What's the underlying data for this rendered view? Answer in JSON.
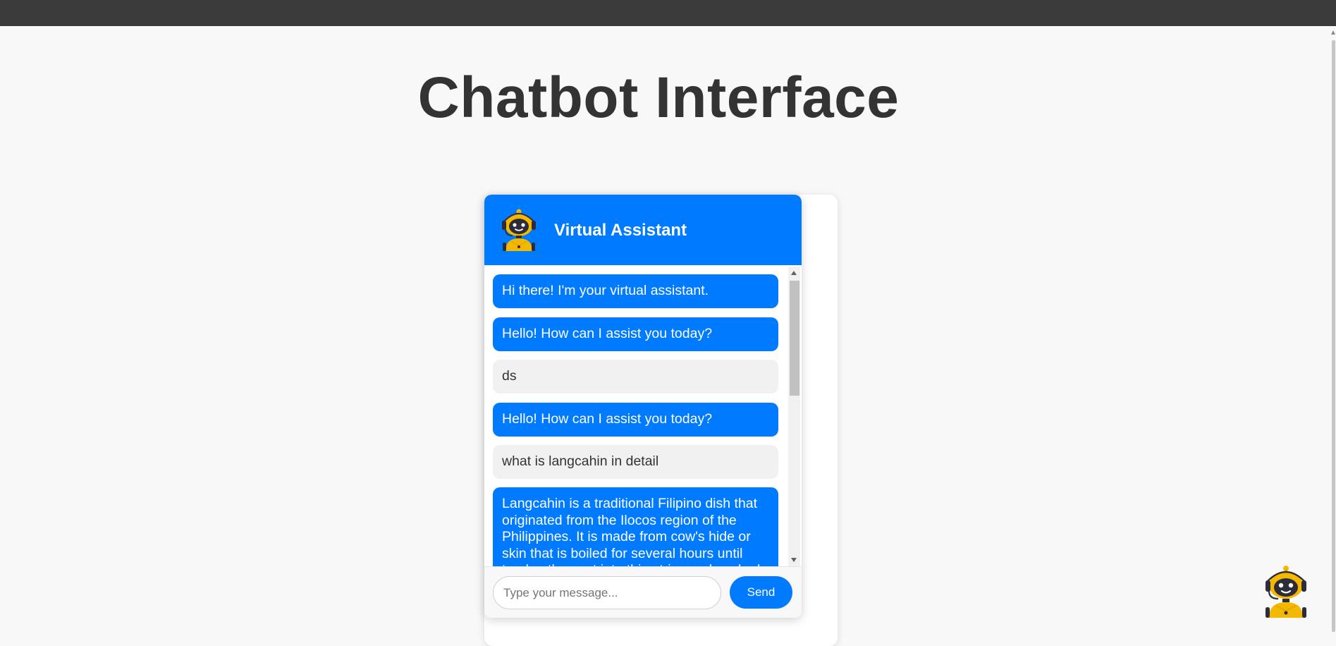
{
  "page": {
    "title": "Chatbot Interface"
  },
  "chat": {
    "header_title": "Virtual Assistant",
    "messages": [
      {
        "sender": "bot",
        "text": "Hi there! I'm your virtual assistant."
      },
      {
        "sender": "bot",
        "text": "Hello! How can I assist you today?"
      },
      {
        "sender": "user",
        "text": "ds"
      },
      {
        "sender": "bot",
        "text": "Hello! How can I assist you today?"
      },
      {
        "sender": "user",
        "text": "what is langcahin in detail"
      },
      {
        "sender": "bot",
        "text": "Langcahin is a traditional Filipino dish that originated from the Ilocos region of the Philippines. It is made from cow's hide or skin that is boiled for several hours until tender, then cut into thin strips and cooked"
      }
    ],
    "input": {
      "placeholder": "Type your message...",
      "value": ""
    },
    "send_label": "Send"
  },
  "colors": {
    "accent": "#007bff",
    "top_bar": "#3b3b3b",
    "bot_bubble": "#007bff",
    "user_bubble": "#f1f1f1",
    "robot_body": "#f5b800",
    "robot_face": "#2d2d3a"
  },
  "icons": {
    "header_avatar": "robot-avatar-icon",
    "launcher": "robot-launcher-icon"
  }
}
